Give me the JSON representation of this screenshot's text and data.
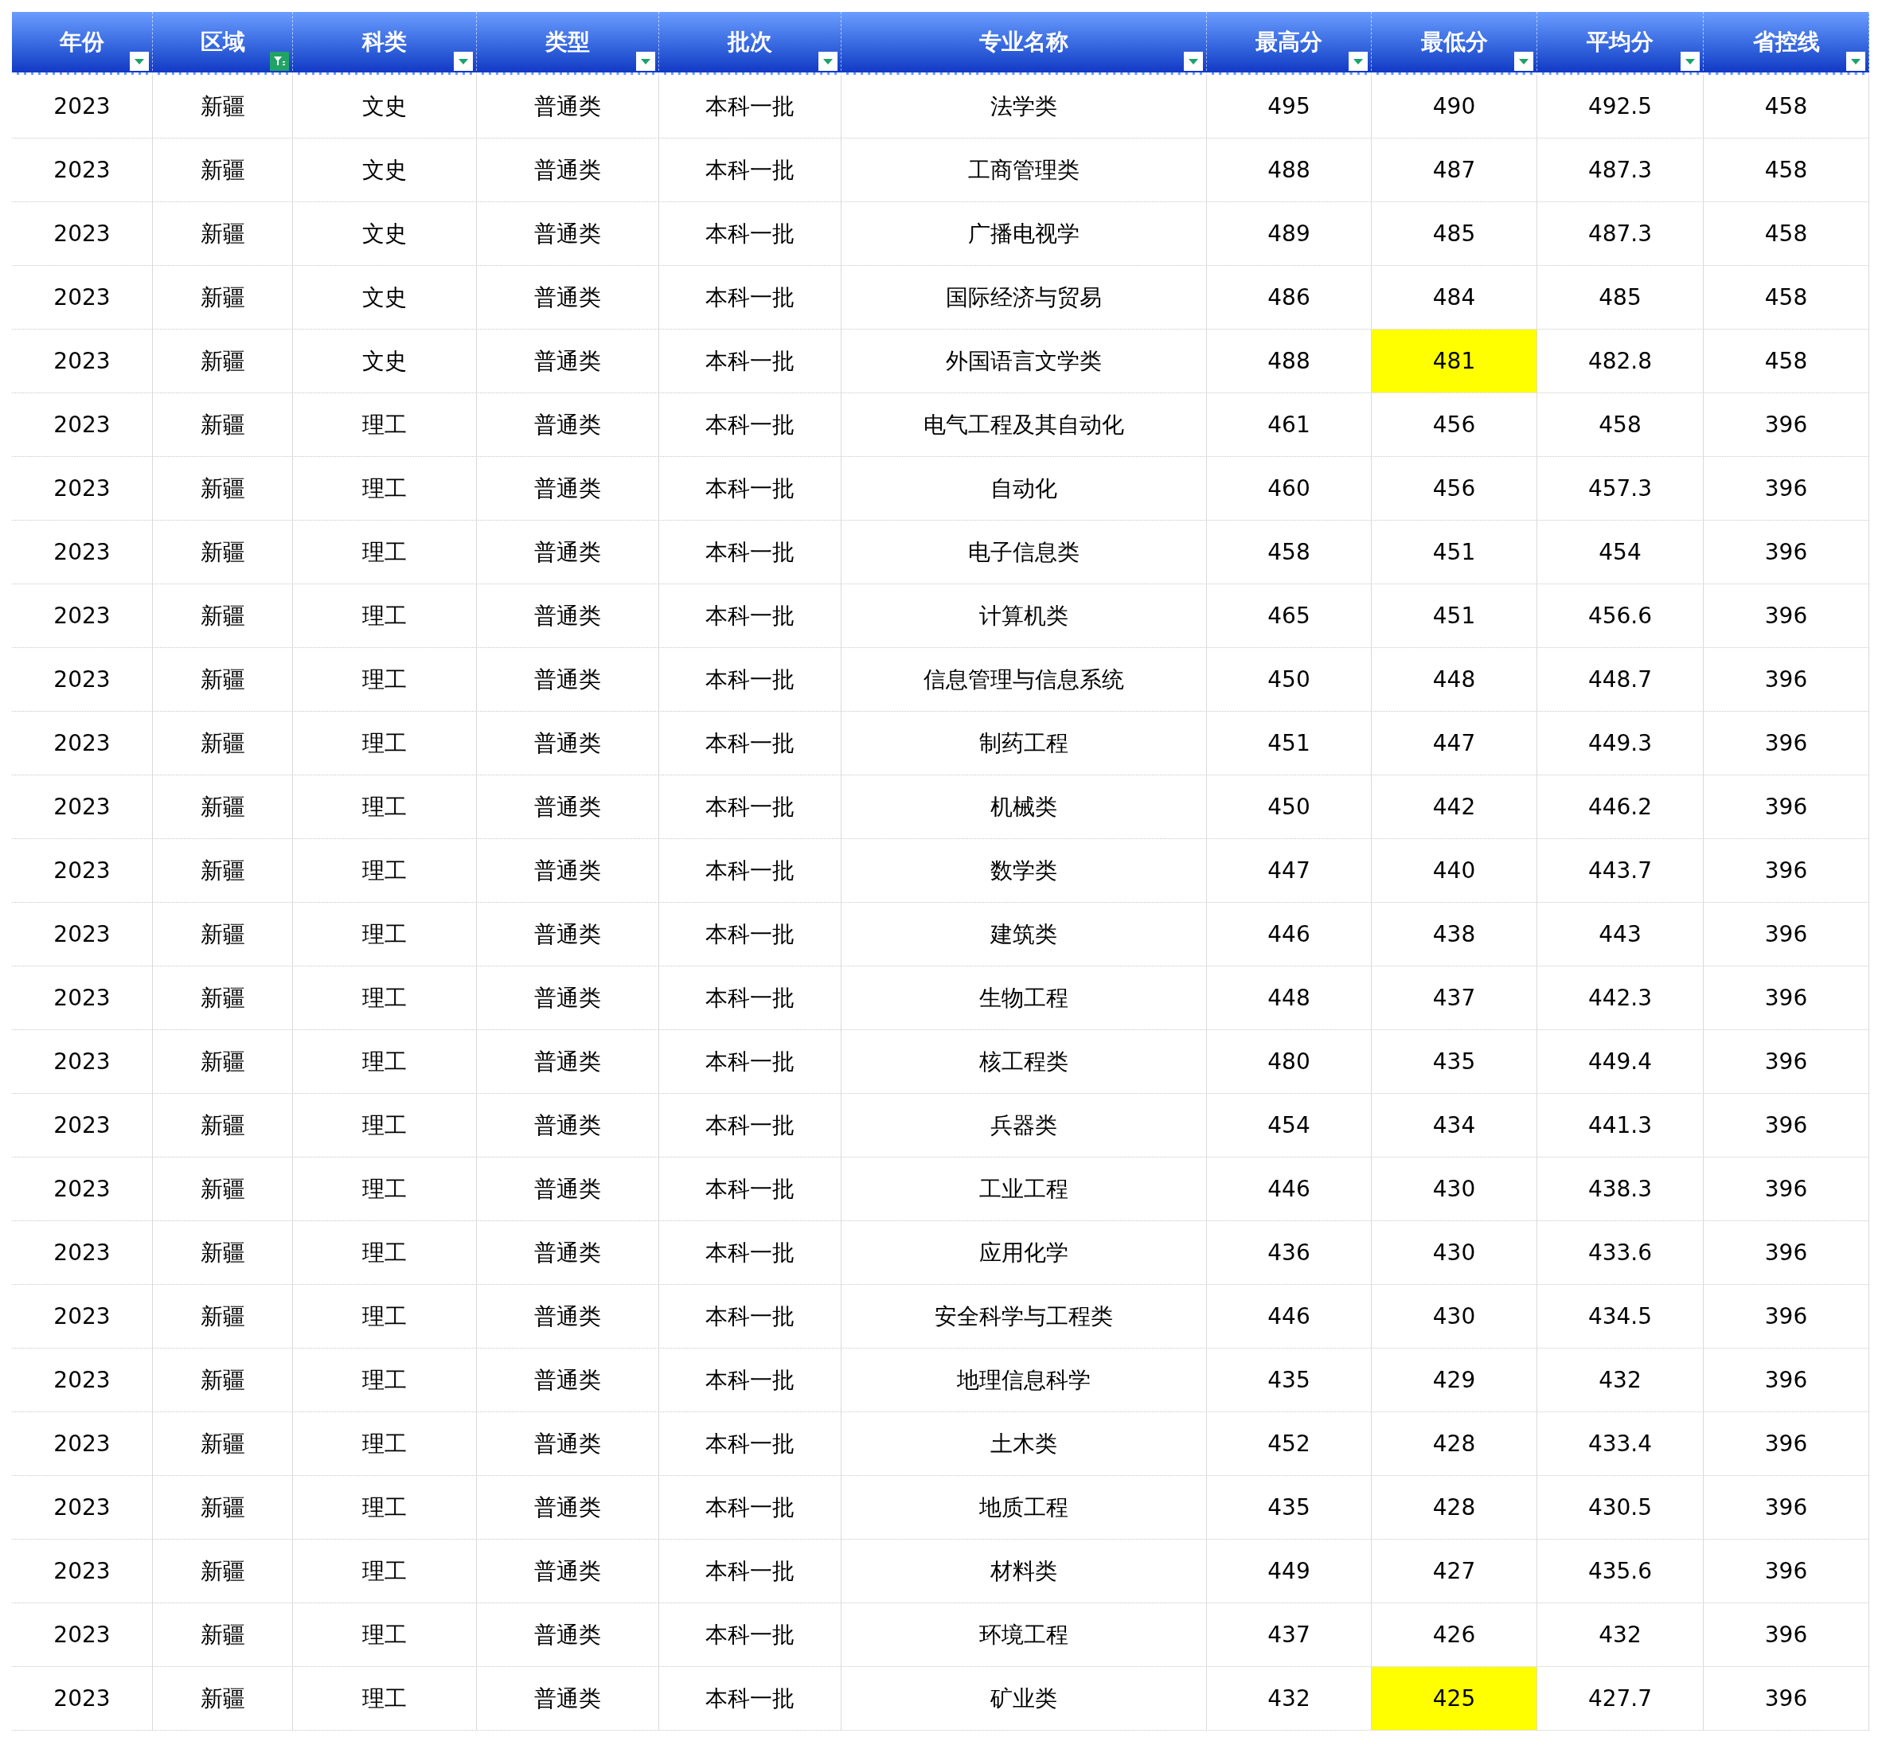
{
  "columns": [
    {
      "label": "年份",
      "filter_active": false
    },
    {
      "label": "区域",
      "filter_active": true
    },
    {
      "label": "科类",
      "filter_active": false
    },
    {
      "label": "类型",
      "filter_active": false
    },
    {
      "label": "批次",
      "filter_active": false
    },
    {
      "label": "专业名称",
      "filter_active": false
    },
    {
      "label": "最高分",
      "filter_active": false
    },
    {
      "label": "最低分",
      "filter_active": false
    },
    {
      "label": "平均分",
      "filter_active": false
    },
    {
      "label": "省控线",
      "filter_active": false
    }
  ],
  "rows": [
    {
      "cells": [
        "2023",
        "新疆",
        "文史",
        "普通类",
        "本科一批",
        "法学类",
        "495",
        "490",
        "492.5",
        "458"
      ],
      "highlight_min": false
    },
    {
      "cells": [
        "2023",
        "新疆",
        "文史",
        "普通类",
        "本科一批",
        "工商管理类",
        "488",
        "487",
        "487.3",
        "458"
      ],
      "highlight_min": false
    },
    {
      "cells": [
        "2023",
        "新疆",
        "文史",
        "普通类",
        "本科一批",
        "广播电视学",
        "489",
        "485",
        "487.3",
        "458"
      ],
      "highlight_min": false
    },
    {
      "cells": [
        "2023",
        "新疆",
        "文史",
        "普通类",
        "本科一批",
        "国际经济与贸易",
        "486",
        "484",
        "485",
        "458"
      ],
      "highlight_min": false
    },
    {
      "cells": [
        "2023",
        "新疆",
        "文史",
        "普通类",
        "本科一批",
        "外国语言文学类",
        "488",
        "481",
        "482.8",
        "458"
      ],
      "highlight_min": true
    },
    {
      "cells": [
        "2023",
        "新疆",
        "理工",
        "普通类",
        "本科一批",
        "电气工程及其自动化",
        "461",
        "456",
        "458",
        "396"
      ],
      "highlight_min": false
    },
    {
      "cells": [
        "2023",
        "新疆",
        "理工",
        "普通类",
        "本科一批",
        "自动化",
        "460",
        "456",
        "457.3",
        "396"
      ],
      "highlight_min": false
    },
    {
      "cells": [
        "2023",
        "新疆",
        "理工",
        "普通类",
        "本科一批",
        "电子信息类",
        "458",
        "451",
        "454",
        "396"
      ],
      "highlight_min": false
    },
    {
      "cells": [
        "2023",
        "新疆",
        "理工",
        "普通类",
        "本科一批",
        "计算机类",
        "465",
        "451",
        "456.6",
        "396"
      ],
      "highlight_min": false
    },
    {
      "cells": [
        "2023",
        "新疆",
        "理工",
        "普通类",
        "本科一批",
        "信息管理与信息系统",
        "450",
        "448",
        "448.7",
        "396"
      ],
      "highlight_min": false
    },
    {
      "cells": [
        "2023",
        "新疆",
        "理工",
        "普通类",
        "本科一批",
        "制药工程",
        "451",
        "447",
        "449.3",
        "396"
      ],
      "highlight_min": false
    },
    {
      "cells": [
        "2023",
        "新疆",
        "理工",
        "普通类",
        "本科一批",
        "机械类",
        "450",
        "442",
        "446.2",
        "396"
      ],
      "highlight_min": false
    },
    {
      "cells": [
        "2023",
        "新疆",
        "理工",
        "普通类",
        "本科一批",
        "数学类",
        "447",
        "440",
        "443.7",
        "396"
      ],
      "highlight_min": false
    },
    {
      "cells": [
        "2023",
        "新疆",
        "理工",
        "普通类",
        "本科一批",
        "建筑类",
        "446",
        "438",
        "443",
        "396"
      ],
      "highlight_min": false
    },
    {
      "cells": [
        "2023",
        "新疆",
        "理工",
        "普通类",
        "本科一批",
        "生物工程",
        "448",
        "437",
        "442.3",
        "396"
      ],
      "highlight_min": false
    },
    {
      "cells": [
        "2023",
        "新疆",
        "理工",
        "普通类",
        "本科一批",
        "核工程类",
        "480",
        "435",
        "449.4",
        "396"
      ],
      "highlight_min": false
    },
    {
      "cells": [
        "2023",
        "新疆",
        "理工",
        "普通类",
        "本科一批",
        "兵器类",
        "454",
        "434",
        "441.3",
        "396"
      ],
      "highlight_min": false
    },
    {
      "cells": [
        "2023",
        "新疆",
        "理工",
        "普通类",
        "本科一批",
        "工业工程",
        "446",
        "430",
        "438.3",
        "396"
      ],
      "highlight_min": false
    },
    {
      "cells": [
        "2023",
        "新疆",
        "理工",
        "普通类",
        "本科一批",
        "应用化学",
        "436",
        "430",
        "433.6",
        "396"
      ],
      "highlight_min": false
    },
    {
      "cells": [
        "2023",
        "新疆",
        "理工",
        "普通类",
        "本科一批",
        "安全科学与工程类",
        "446",
        "430",
        "434.5",
        "396"
      ],
      "highlight_min": false
    },
    {
      "cells": [
        "2023",
        "新疆",
        "理工",
        "普通类",
        "本科一批",
        "地理信息科学",
        "435",
        "429",
        "432",
        "396"
      ],
      "highlight_min": false
    },
    {
      "cells": [
        "2023",
        "新疆",
        "理工",
        "普通类",
        "本科一批",
        "土木类",
        "452",
        "428",
        "433.4",
        "396"
      ],
      "highlight_min": false
    },
    {
      "cells": [
        "2023",
        "新疆",
        "理工",
        "普通类",
        "本科一批",
        "地质工程",
        "435",
        "428",
        "430.5",
        "396"
      ],
      "highlight_min": false
    },
    {
      "cells": [
        "2023",
        "新疆",
        "理工",
        "普通类",
        "本科一批",
        "材料类",
        "449",
        "427",
        "435.6",
        "396"
      ],
      "highlight_min": false
    },
    {
      "cells": [
        "2023",
        "新疆",
        "理工",
        "普通类",
        "本科一批",
        "环境工程",
        "437",
        "426",
        "432",
        "396"
      ],
      "highlight_min": false
    },
    {
      "cells": [
        "2023",
        "新疆",
        "理工",
        "普通类",
        "本科一批",
        "矿业类",
        "432",
        "425",
        "427.7",
        "396"
      ],
      "highlight_min": true
    }
  ]
}
